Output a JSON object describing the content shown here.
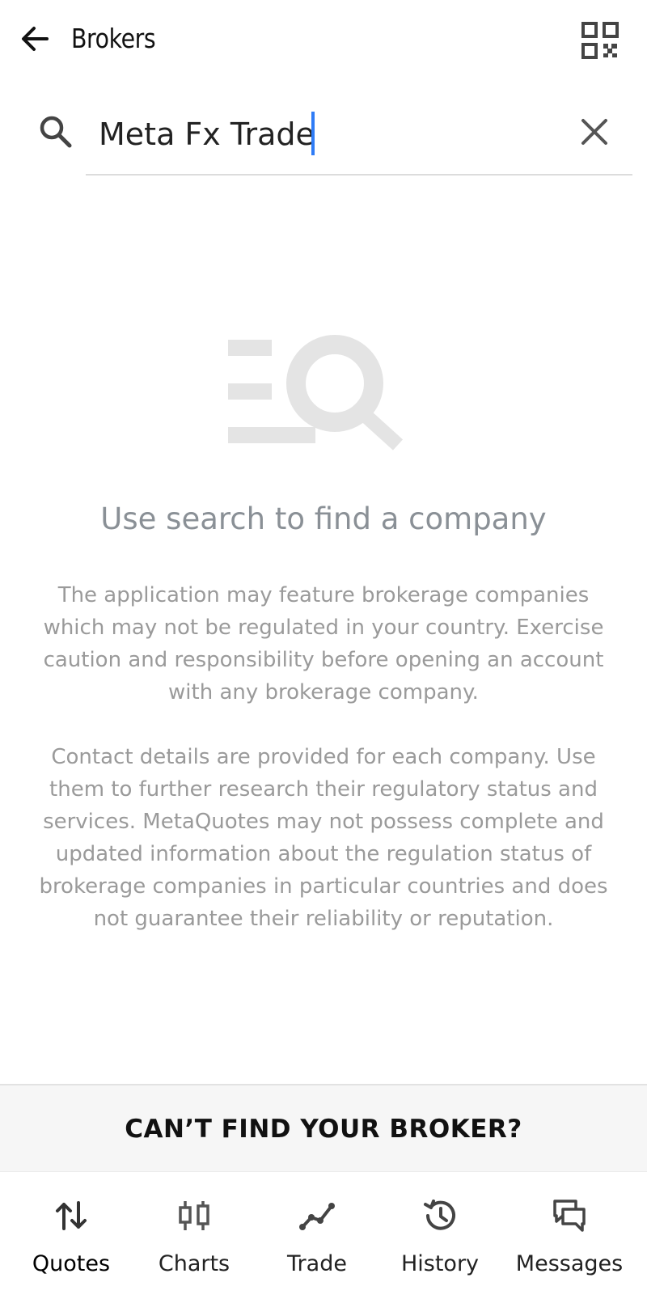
{
  "header": {
    "title": "Brokers",
    "back_icon": "arrow-left-icon",
    "qr_icon": "qr-code-icon"
  },
  "search": {
    "value": "Meta Fx Trade",
    "placeholder": "",
    "search_icon": "search-icon",
    "clear_icon": "close-icon",
    "cursor_color": "#2f7cf6"
  },
  "empty_state": {
    "illustration_icon": "empty-search-illustration",
    "title": "Use search to find a company",
    "disclaimer_1": "The application may feature brokerage companies which may not be regulated in your country. Exercise caution and responsibility before opening an account with any brokerage company.",
    "disclaimer_2": "Contact details are provided for each company. Use them to further research their regulatory status and services. MetaQuotes may not possess complete and updated information about the regulation status of brokerage companies in particular countries and does not guarantee their reliability or reputation."
  },
  "cta": {
    "label": "CAN’T FIND YOUR BROKER?"
  },
  "bottom_nav": {
    "items": [
      {
        "label": "Quotes",
        "icon": "quotes-arrows-icon",
        "active": true
      },
      {
        "label": "Charts",
        "icon": "candlestick-chart-icon",
        "active": false
      },
      {
        "label": "Trade",
        "icon": "trade-line-icon",
        "active": false
      },
      {
        "label": "History",
        "icon": "history-clock-icon",
        "active": false
      },
      {
        "label": "Messages",
        "icon": "messages-icon",
        "active": false
      }
    ]
  },
  "colors": {
    "accent": "#2f7cf6",
    "muted_text": "#9a9a9a",
    "empty_title": "#8a9096",
    "illustration": "#e4e4e4",
    "cta_background": "#f6f6f6"
  }
}
